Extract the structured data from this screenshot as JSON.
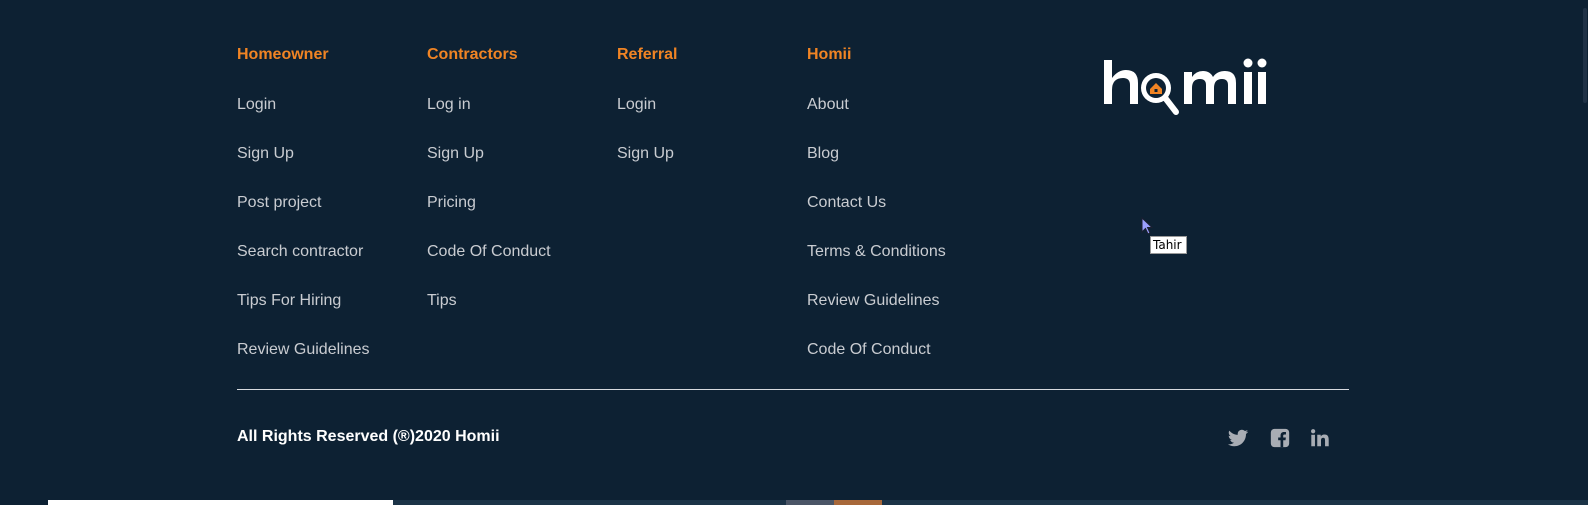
{
  "footer": {
    "columns": [
      {
        "heading": "Homeowner",
        "links": [
          "Login",
          "Sign Up",
          "Post project",
          "Search contractor",
          "Tips For Hiring",
          "Review Guidelines"
        ]
      },
      {
        "heading": "Contractors",
        "links": [
          "Log in",
          "Sign Up",
          "Pricing",
          "Code Of Conduct",
          "Tips"
        ]
      },
      {
        "heading": "Referral",
        "links": [
          "Login",
          "Sign Up"
        ]
      },
      {
        "heading": "Homii",
        "links": [
          "About",
          "Blog",
          "Contact Us",
          "Terms & Conditions",
          "Review Guidelines",
          "Code Of Conduct"
        ]
      }
    ],
    "logo_text": "homii",
    "copyright": "All Rights Reserved (®)2020 Homii",
    "social": [
      {
        "name": "twitter-icon"
      },
      {
        "name": "facebook-icon"
      },
      {
        "name": "linkedin-icon"
      }
    ]
  },
  "tooltip": "Tahir",
  "colors": {
    "background": "#0d2133",
    "accent": "#f08424",
    "link": "#c9ccd1",
    "white": "#ffffff"
  }
}
